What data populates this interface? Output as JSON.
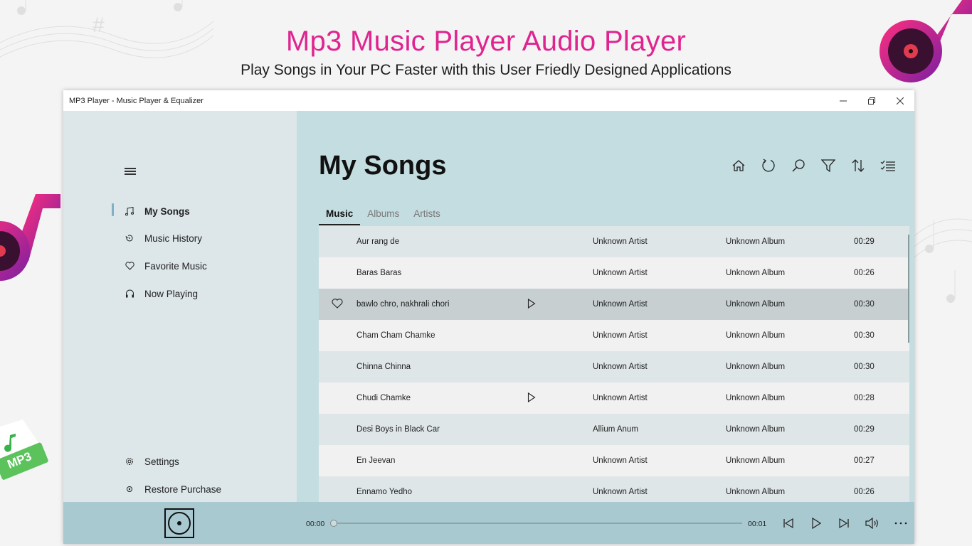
{
  "promo": {
    "title": "Mp3 Music Player Audio Player",
    "subtitle": "Play Songs in Your PC Faster with this User Friedly Designed Applications",
    "badge_text": "MP3"
  },
  "window": {
    "title": "MP3 Player - Music Player & Equalizer",
    "minimize_icon": "minimize-icon",
    "restore_icon": "restore-icon",
    "close_icon": "close-icon"
  },
  "sidebar": {
    "items": [
      {
        "label": "My Songs",
        "icon": "music-note-icon",
        "active": true
      },
      {
        "label": "Music History",
        "icon": "history-icon"
      },
      {
        "label": "Favorite Music",
        "icon": "heart-icon"
      },
      {
        "label": "Now Playing",
        "icon": "headphones-icon"
      }
    ],
    "bottom_items": [
      {
        "label": "Settings",
        "icon": "gear-icon"
      },
      {
        "label": "Restore Purchase",
        "icon": "restore-purchase-icon"
      }
    ]
  },
  "main": {
    "page_title": "My Songs",
    "tabs": [
      {
        "label": "Music",
        "active": true
      },
      {
        "label": "Albums"
      },
      {
        "label": "Artists"
      }
    ],
    "toolbar": [
      "home-icon",
      "refresh-icon",
      "search-icon",
      "filter-icon",
      "sort-icon",
      "select-list-icon"
    ]
  },
  "songs": [
    {
      "title": "Aur rang de",
      "artist": "Unknown Artist",
      "album": "Unknown Album",
      "duration": "00:29"
    },
    {
      "title": "Baras Baras",
      "artist": "Unknown Artist",
      "album": "Unknown Album",
      "duration": "00:26"
    },
    {
      "title": "bawlo chro, nakhrali chori",
      "artist": "Unknown Artist",
      "album": "Unknown Album",
      "duration": "00:30",
      "selected": true
    },
    {
      "title": "Cham Cham Chamke",
      "artist": "Unknown Artist",
      "album": "Unknown Album",
      "duration": "00:30"
    },
    {
      "title": "Chinna Chinna",
      "artist": "Unknown Artist",
      "album": "Unknown Album",
      "duration": "00:30"
    },
    {
      "title": "Chudi Chamke",
      "artist": "Unknown Artist",
      "album": "Unknown Album",
      "duration": "00:28",
      "play_visible": true
    },
    {
      "title": "Desi Boys in Black Car",
      "artist": "Allium Anum",
      "album": "Unknown Album",
      "duration": "00:29"
    },
    {
      "title": "En Jeevan",
      "artist": "Unknown Artist",
      "album": "Unknown Album",
      "duration": "00:27"
    },
    {
      "title": "Ennamo Yedho",
      "artist": "Unknown Artist",
      "album": "Unknown Album",
      "duration": "00:26"
    }
  ],
  "player": {
    "current_time": "00:00",
    "total_time": "00:01",
    "progress": 0,
    "controls": [
      "previous-icon",
      "play-icon",
      "next-icon",
      "volume-icon",
      "more-icon"
    ]
  },
  "colors": {
    "accent_title": "#e0248f",
    "sidebar_bg": "#dde6e9",
    "main_bg": "#c4dde1",
    "player_bg": "#a9c9d1"
  }
}
